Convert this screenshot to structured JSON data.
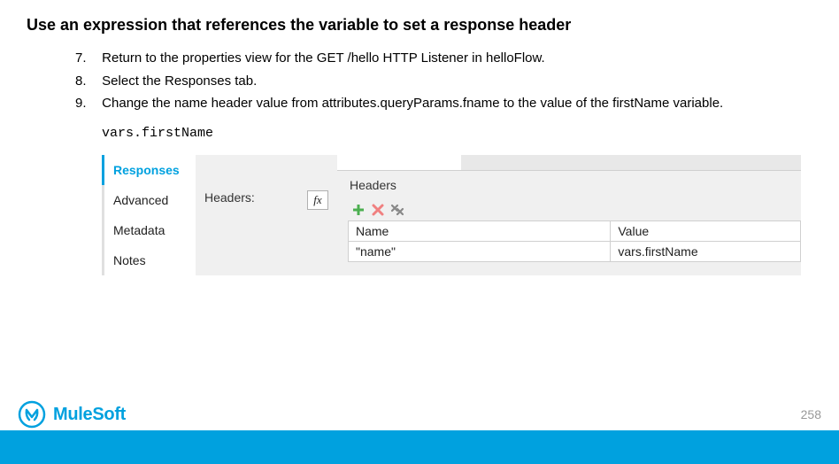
{
  "title": "Use an expression that references the variable to set a response header",
  "steps": [
    {
      "num": "7.",
      "text": "Return to the properties view for the GET /hello HTTP Listener in helloFlow."
    },
    {
      "num": "8.",
      "text": "Select the Responses tab."
    },
    {
      "num": "9.",
      "text": "Change the name header value from attributes.queryParams.fname to the value of the firstName variable."
    }
  ],
  "code_snippet": "vars.firstName",
  "sidebar_tabs": {
    "responses": "Responses",
    "advanced": "Advanced",
    "metadata": "Metadata",
    "notes": "Notes"
  },
  "mid_label": "Headers:",
  "fx_label": "fx",
  "panel": {
    "section_label": "Headers",
    "columns": {
      "name": "Name",
      "value": "Value"
    },
    "row": {
      "name": "\"name\"",
      "value": "vars.firstName"
    }
  },
  "logo_text": "MuleSoft",
  "page_number": "258"
}
